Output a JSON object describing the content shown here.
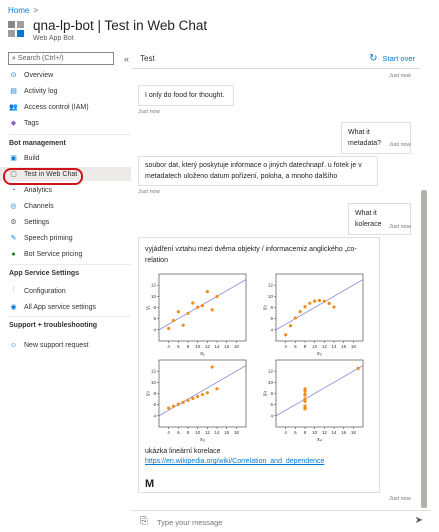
{
  "breadcrumb": {
    "home": "Home",
    "sep": ">"
  },
  "header": {
    "title": "qna-lp-bot | Test in Web Chat",
    "subtitle": "Web App Bot"
  },
  "sidebar": {
    "search_placeholder": "Search (Ctrl+/)",
    "collapse": "«",
    "items_top": [
      {
        "label": "Overview",
        "icon": "overview-icon",
        "glyph": "⊙",
        "color": "#0078d4"
      },
      {
        "label": "Activity log",
        "icon": "activity-log-icon",
        "glyph": "▤",
        "color": "#0078d4"
      },
      {
        "label": "Access control (IAM)",
        "icon": "people-icon",
        "glyph": "👥",
        "color": "#0078d4"
      },
      {
        "label": "Tags",
        "icon": "tag-icon",
        "glyph": "◆",
        "color": "#8661c5"
      }
    ],
    "section_bot": "Bot management",
    "items_bot": [
      {
        "label": "Build",
        "icon": "build-icon",
        "glyph": "▣",
        "color": "#0078d4"
      },
      {
        "label": "Test in Web Chat",
        "icon": "chat-icon",
        "glyph": "▢",
        "color": "#605e5c"
      },
      {
        "label": "Analytics",
        "icon": "analytics-icon",
        "glyph": "◔",
        "color": "#0078d4"
      },
      {
        "label": "Channels",
        "icon": "channels-icon",
        "glyph": "◎",
        "color": "#0078d4"
      },
      {
        "label": "Settings",
        "icon": "gear-icon",
        "glyph": "⚙",
        "color": "#605e5c"
      },
      {
        "label": "Speech priming",
        "icon": "speech-icon",
        "glyph": "✎",
        "color": "#0078d4"
      },
      {
        "label": "Bot Service pricing",
        "icon": "pricing-icon",
        "glyph": "●",
        "color": "#107c10"
      }
    ],
    "section_app": "App Service Settings",
    "items_app": [
      {
        "label": "Configuration",
        "icon": "configuration-icon",
        "glyph": "⫶",
        "color": "#0078d4"
      },
      {
        "label": "All App service settings",
        "icon": "app-service-icon",
        "glyph": "◉",
        "color": "#0078d4"
      }
    ],
    "section_support": "Support + troubleshooting",
    "items_support": [
      {
        "label": "New support request",
        "icon": "support-icon",
        "glyph": "☺",
        "color": "#0078d4"
      }
    ]
  },
  "chat": {
    "title": "Test",
    "start_over": "Start over",
    "ts": "Just now",
    "messages": [
      {
        "from": "bot",
        "text": "I only do food for thought."
      },
      {
        "from": "user",
        "text": "What it metadata?"
      },
      {
        "from": "bot",
        "text": "soubor dat, který poskytuje informace o jiných datechnapř. u fotek je v metadatech uloženo datum pořízení, poloha, a mnoho dalšího"
      },
      {
        "from": "user",
        "text": "What it kolerace"
      },
      {
        "from": "bot",
        "text": "vyjádření vztahu mezi dvěma objekty / informacemiz anglického „co-relation"
      }
    ],
    "card_caption": "ukázka lineární korelace",
    "card_link": "https://en.wikipedia.org/wiki/Correlation_and_dependence",
    "card_signature": "M",
    "input_placeholder": "Type your message",
    "plot_labels": {
      "x": [
        "x₁",
        "x₂",
        "x₃",
        "x₄"
      ],
      "y": [
        "y₁",
        "y₂",
        "y₃",
        "y₄"
      ],
      "xticks": [
        "4",
        "6",
        "8",
        "10",
        "12",
        "14",
        "16",
        "18"
      ],
      "yticks": [
        "4",
        "6",
        "8",
        "10",
        "12"
      ]
    }
  }
}
